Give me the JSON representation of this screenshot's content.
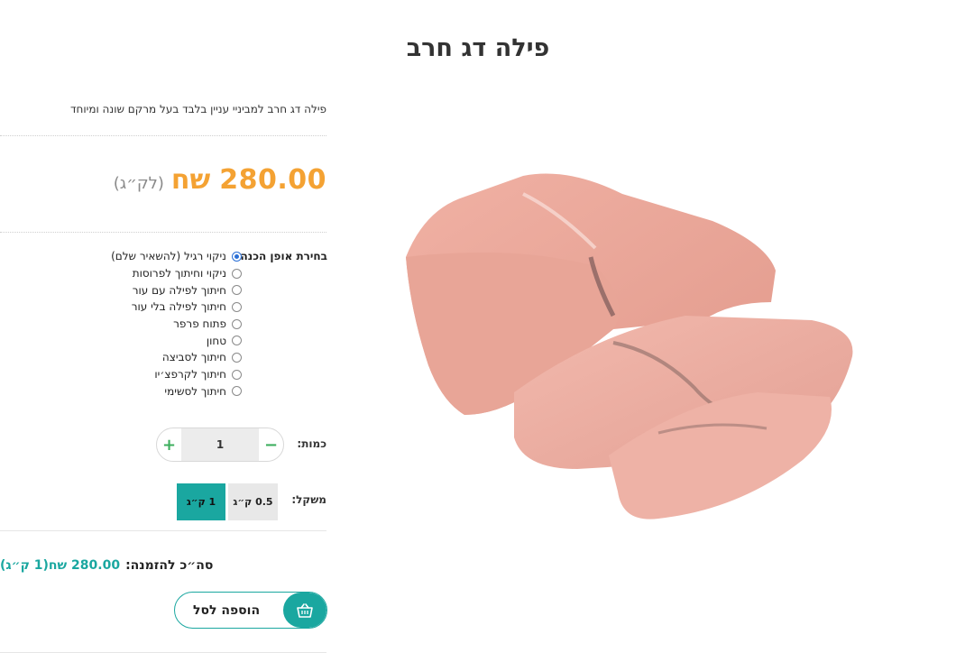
{
  "product": {
    "title": "פילה דג חרב",
    "description": "פילה דג חרב למביניי עניין בלבד בעל מרקם שונה ומיוחד",
    "price_value": "280.00",
    "price_currency": "שח",
    "price_unit": "(לק״ג)"
  },
  "preparation": {
    "label": "בחירת אופן הכנה:",
    "selected": "ניקוי רגיל (להשאיר שלם)",
    "options": [
      "ניקוי רגיל (להשאיר שלם)",
      "ניקוי וחיתוך לפרוסות",
      "חיתוך לפילה עם עור",
      "חיתוך לפילה בלי עור",
      "פתוח פרפר",
      "טחון",
      "חיתוך לסביצה",
      "חיתוך לקרפצ׳יו",
      "חיתוך לסשימי"
    ]
  },
  "quantity": {
    "label": "כמות:",
    "value": "1",
    "minus": "−",
    "plus": "+"
  },
  "weight": {
    "label": "משקל:",
    "options": [
      "0.5 ק״ג",
      "1 ק״ג"
    ],
    "selected": "1 ק״ג"
  },
  "order_total": {
    "label": "סה״כ להזמנה:",
    "value": "280.00 שח(1 ק״ג)"
  },
  "cart": {
    "add_label": "הוספה לסל"
  },
  "colors": {
    "accent": "#1aa7a0",
    "price": "#f4a233",
    "stepper_icons": "#3cae5d"
  },
  "icons": {
    "cart": "basket-icon"
  }
}
